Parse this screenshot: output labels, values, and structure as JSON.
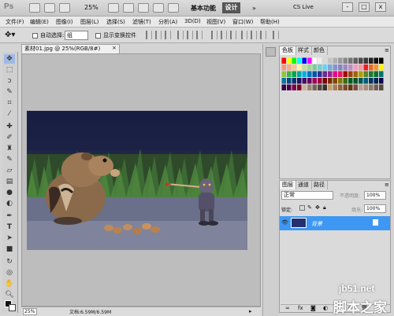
{
  "title_bar": {
    "logo": "Ps",
    "zoom": "25%",
    "workspace_basic": "基本功能",
    "workspace_design": "设计",
    "cs_live": "CS Live",
    "win_min": "-",
    "win_max": "□",
    "win_close": "x"
  },
  "menu": [
    "文件(F)",
    "编辑(E)",
    "图像(I)",
    "图层(L)",
    "选择(S)",
    "滤镜(T)",
    "分析(A)",
    "3D(D)",
    "视图(V)",
    "窗口(W)",
    "帮助(H)"
  ],
  "options_bar": {
    "auto_select": "自动选择:",
    "group": "组",
    "show_transform": "显示变换控件"
  },
  "document": {
    "tab_title": "素材01.jpg @ 25%(RGB/8#)",
    "zoom": "25%",
    "doc_info": "文档:6.59M/6.59M"
  },
  "swatch_panel": {
    "tabs": [
      "色板",
      "样式",
      "颜色"
    ]
  },
  "layers_panel": {
    "tabs": [
      "图层",
      "通道",
      "路径"
    ],
    "blend_mode": "正常",
    "opacity_label": "不透明度:",
    "opacity": "100%",
    "lock_label": "锁定:",
    "fill_label": "填充:",
    "fill": "100%",
    "layer_name": "背景"
  },
  "watermark": {
    "site": "jb51.net",
    "name": "脚本之家"
  },
  "icons": [
    "move-icon",
    "marquee-icon",
    "lasso-icon",
    "quick-select-icon",
    "crop-icon",
    "eyedropper-icon",
    "healing-icon",
    "brush-icon",
    "stamp-icon",
    "history-brush-icon",
    "eraser-icon",
    "gradient-icon",
    "blur-icon",
    "dodge-icon",
    "pen-icon",
    "type-icon",
    "path-select-icon",
    "shape-icon",
    "3d-rotate-icon",
    "3d-orbit-icon",
    "hand-icon",
    "zoom-icon",
    "eye-icon",
    "lock-icon"
  ],
  "colors": {
    "selected_layer": "#3e97f2",
    "workspace_active": "#555555",
    "canvas_bg": "#bdbdbd"
  }
}
